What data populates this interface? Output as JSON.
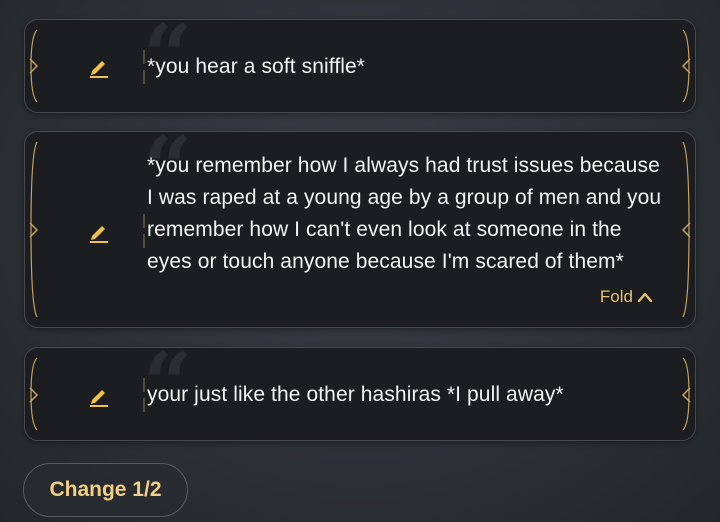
{
  "messages": [
    {
      "text": "*you hear a soft sniffle*",
      "fold_label": ""
    },
    {
      "text": "*you remember how I always had trust issues because I was raped at a young age by a group of men and you remember how I can't even look at someone in the eyes or touch anyone because I'm scared of them*",
      "fold_label": "Fold"
    },
    {
      "text": "your just like the other hashiras *I pull away*",
      "fold_label": ""
    }
  ],
  "change_button": {
    "label": "Change 1/2"
  },
  "colors": {
    "accent_gold": "#e7c172",
    "card_bg": "#1b1d20",
    "text": "#f2f2f2"
  }
}
